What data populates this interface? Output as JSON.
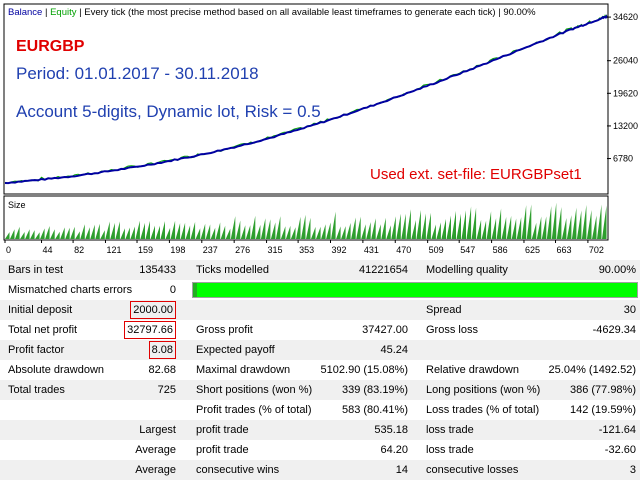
{
  "chart": {
    "legend_balance": "Balance",
    "legend_equity": "Equity",
    "legend_note": "Every tick (the most precise method based on all available least timeframes to generate each tick)",
    "legend_quality": "90.00%",
    "symbol": "EURGBP",
    "period": "Period: 01.01.2017 - 30.11.2018",
    "account": "Account 5-digits, Dynamic lot, Risk = 0.5",
    "set_file": "Used ext. set-file: EURGBPset1",
    "size_label": "Size",
    "colors": {
      "balance": "#0000a0",
      "equity": "#00a000",
      "volume": "#2e9e2e",
      "red_text": "#e00000",
      "blue_text": "#2040b0"
    }
  },
  "chart_data": {
    "type": "line",
    "title": "",
    "xlabel": "",
    "ylabel": "",
    "x_ticks": [
      "0",
      "44",
      "82",
      "121",
      "159",
      "198",
      "237",
      "276",
      "315",
      "353",
      "392",
      "431",
      "470",
      "509",
      "547",
      "586",
      "625",
      "663",
      "702"
    ],
    "y_ticks": [
      "34620",
      "26040",
      "19620",
      "13200",
      "6780"
    ],
    "ylim": [
      0,
      37000
    ],
    "xlim": [
      0,
      725
    ],
    "series": [
      {
        "name": "Balance",
        "x": [
          0,
          40,
          80,
          120,
          160,
          200,
          240,
          280,
          320,
          360,
          400,
          440,
          480,
          520,
          560,
          600,
          640,
          680,
          700,
          720,
          725
        ],
        "y": [
          2000,
          2600,
          3300,
          4200,
          5200,
          6400,
          7700,
          9200,
          10900,
          12800,
          14900,
          17100,
          19400,
          21800,
          24300,
          26900,
          29500,
          32100,
          33300,
          34500,
          34797
        ]
      }
    ],
    "volume_series": {
      "name": "Size",
      "description_free": true
    }
  },
  "report": {
    "bars_in_test_label": "Bars in test",
    "bars_in_test": "135433",
    "ticks_modelled_label": "Ticks modelled",
    "ticks_modelled": "41221654",
    "modelling_quality_label": "Modelling quality",
    "modelling_quality": "90.00%",
    "modelling_quality_fraction": 0.9,
    "mismatched_label": "Mismatched charts errors",
    "mismatched": "0",
    "initial_deposit_label": "Initial deposit",
    "initial_deposit": "2000.00",
    "spread_label": "Spread",
    "spread": "30",
    "net_profit_label": "Total net profit",
    "net_profit": "32797.66",
    "gross_profit_label": "Gross profit",
    "gross_profit": "37427.00",
    "gross_loss_label": "Gross loss",
    "gross_loss": "-4629.34",
    "profit_factor_label": "Profit factor",
    "profit_factor": "8.08",
    "expected_payoff_label": "Expected payoff",
    "expected_payoff": "45.24",
    "abs_drawdown_label": "Absolute drawdown",
    "abs_drawdown": "82.68",
    "max_drawdown_label": "Maximal drawdown",
    "max_drawdown": "5102.90 (15.08%)",
    "rel_drawdown_label": "Relative drawdown",
    "rel_drawdown": "25.04% (1492.52)",
    "total_trades_label": "Total trades",
    "total_trades": "725",
    "short_label": "Short positions (won %)",
    "short": "339 (83.19%)",
    "long_label": "Long positions (won %)",
    "long": "386 (77.98%)",
    "profit_trades_label": "Profit trades (% of total)",
    "profit_trades": "583 (80.41%)",
    "loss_trades_label": "Loss trades (% of total)",
    "loss_trades": "142 (19.59%)",
    "largest_label": "Largest",
    "largest_profit_label": "profit trade",
    "largest_profit": "535.18",
    "largest_loss_label": "loss trade",
    "largest_loss": "-121.64",
    "average_label": "Average",
    "average_profit_label": "profit trade",
    "average_profit": "64.20",
    "average_loss_label": "loss trade",
    "average_loss": "-32.60",
    "average2_label": "Average",
    "consec_wins_label": "consecutive wins",
    "consec_wins": "14",
    "consec_losses_label": "consecutive losses",
    "consec_losses": "3"
  }
}
